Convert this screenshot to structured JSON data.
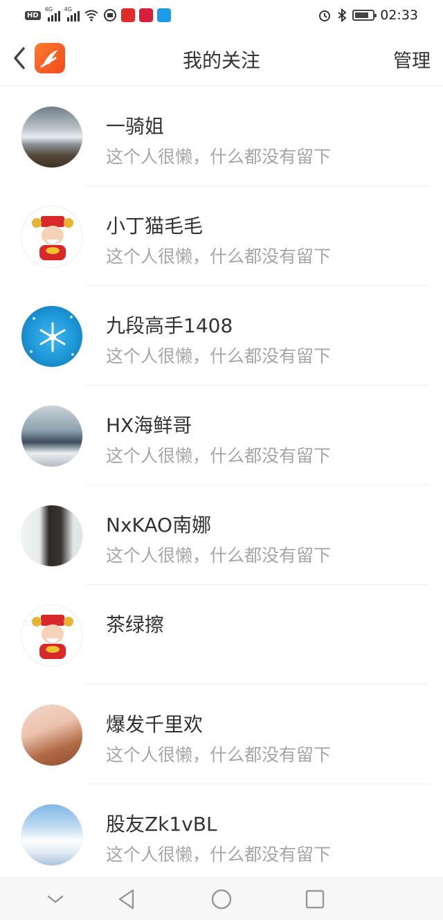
{
  "status_bar": {
    "left_icons": [
      "hd-icon",
      "signal-4g-icon",
      "signal-4g-icon",
      "wifi-icon",
      "vpn-icon",
      "app-icon-red",
      "app-icon-red",
      "app-icon-blue"
    ],
    "right_icons": [
      "alarm-icon",
      "bluetooth-icon",
      "battery-icon"
    ],
    "time": "02:33",
    "hd_label": "HD",
    "net_label": "4G"
  },
  "nav": {
    "title": "我的关注",
    "manage_label": "管理"
  },
  "follows": [
    {
      "name": "一骑姐",
      "signature": "这个人很懒，什么都没有留下",
      "avatar": "landscape-sky"
    },
    {
      "name": "小丁猫毛毛",
      "signature": "这个人很懒，什么都没有留下",
      "avatar": "god-of-wealth"
    },
    {
      "name": "九段高手1408",
      "signature": "这个人很懒，什么都没有留下",
      "avatar": "snowflake"
    },
    {
      "name": "HX海鲜哥",
      "signature": "这个人很懒，什么都没有留下",
      "avatar": "people-outdoor"
    },
    {
      "name": "NxKAO南娜",
      "signature": "这个人很懒，什么都没有留下",
      "avatar": "girl-portrait"
    },
    {
      "name": "茶绿擦",
      "signature": "",
      "avatar": "god-of-wealth"
    },
    {
      "name": "爆发千里欢",
      "signature": "这个人很懒，什么都没有留下",
      "avatar": "girl-with-dog"
    },
    {
      "name": "股友Zk1vBL",
      "signature": "这个人很懒，什么都没有留下",
      "avatar": "winter-scene"
    }
  ],
  "system_nav": [
    "collapse-icon",
    "back-triangle-icon",
    "home-circle-icon",
    "recents-square-icon"
  ],
  "colors": {
    "accent_logo": "#f04a1c",
    "text_primary": "#333333",
    "text_secondary": "#a6a6a6",
    "divider": "#ededed"
  }
}
